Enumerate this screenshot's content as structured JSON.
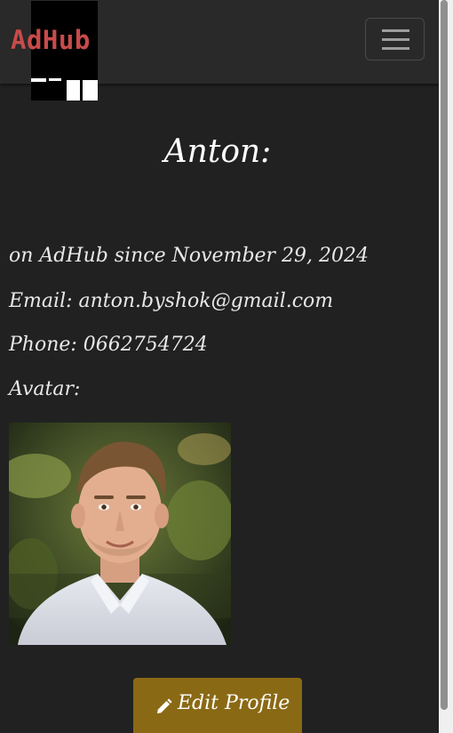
{
  "brand": {
    "logo_text": "AdHub"
  },
  "navbar": {
    "toggle_icon": "hamburger-menu-icon"
  },
  "profile": {
    "title": "Anton:",
    "member_since": "on AdHub since November 29, 2024",
    "email": "Email: anton.byshok@gmail.com",
    "phone": "Phone: 0662754724",
    "avatar_label": "Avatar:",
    "edit_button_label": "Edit Profile",
    "edit_icon": "pencil-icon"
  },
  "colors": {
    "background": "#212121",
    "navbar": "#292929",
    "logo_red": "#c84b4b",
    "button": "#8a6914"
  }
}
